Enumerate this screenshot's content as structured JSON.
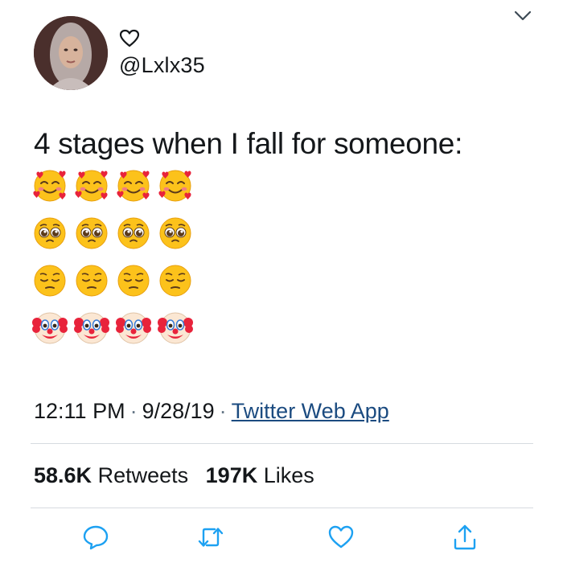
{
  "header": {
    "handle": "@Lxlx35",
    "menu_icon": "chevron-down-icon",
    "badge_icon": "heart-outline-icon"
  },
  "tweet": {
    "text": "4 stages when I fall for someone:",
    "emoji_rows": [
      [
        "smiling-face-with-hearts",
        "smiling-face-with-hearts",
        "smiling-face-with-hearts",
        "smiling-face-with-hearts"
      ],
      [
        "pleading-face",
        "pleading-face",
        "pleading-face",
        "pleading-face"
      ],
      [
        "pensive-face",
        "pensive-face",
        "pensive-face",
        "pensive-face"
      ],
      [
        "clown-face",
        "clown-face",
        "clown-face",
        "clown-face"
      ]
    ]
  },
  "meta": {
    "time": "12:11 PM",
    "date": "9/28/19",
    "separator": "·",
    "app": "Twitter Web App"
  },
  "stats": {
    "retweets_count": "58.6K",
    "retweets_label": "Retweets",
    "likes_count": "197K",
    "likes_label": "Likes"
  },
  "actions": [
    "reply-icon",
    "retweet-icon",
    "like-icon",
    "share-icon"
  ],
  "colors": {
    "text": "#14171a",
    "divider": "#d6dbe0",
    "link": "#1b4b80",
    "icon": "#1da1f2"
  }
}
